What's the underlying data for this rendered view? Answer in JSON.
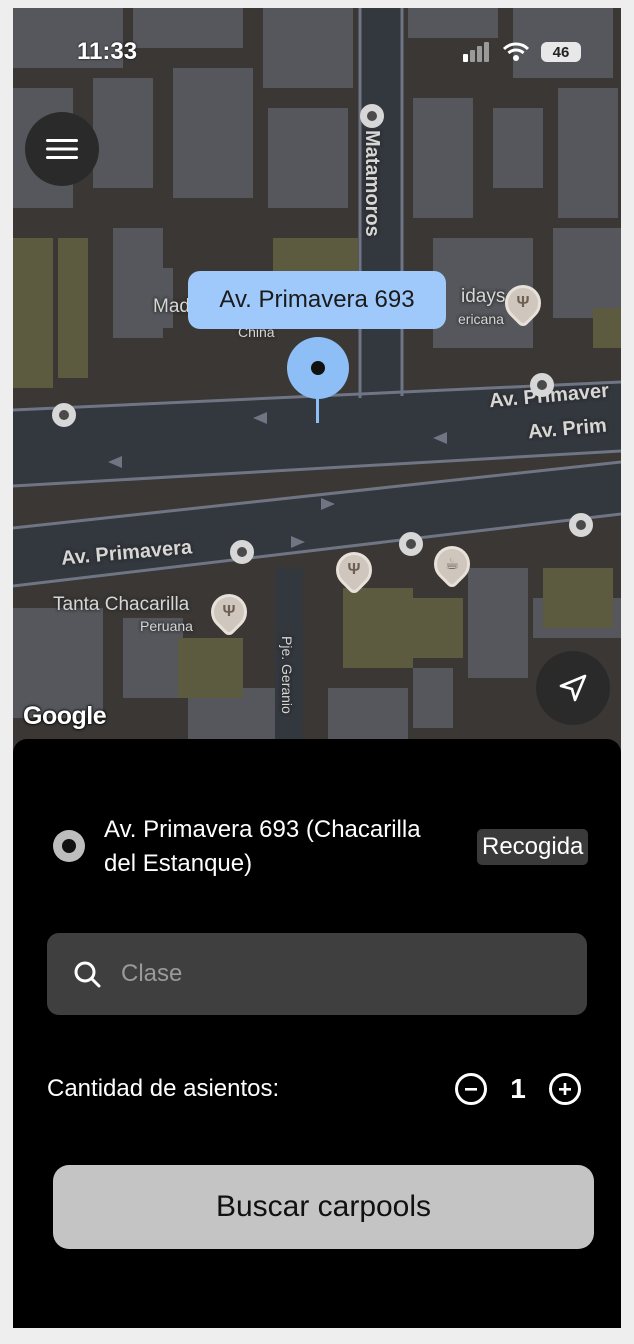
{
  "status_bar": {
    "time": "11:33",
    "battery": "46"
  },
  "map": {
    "pin_address": "Av. Primavera 693",
    "google_logo": "Google",
    "labels": {
      "matamoros": "Matamoros",
      "av_primavera_left": "Av. Primavera",
      "av_primavera_right": "Av. Primaver",
      "av_prim_right": "Av. Prim",
      "tanta": "Tanta Chacarilla",
      "peruana": "Peruana",
      "fridays": "idays",
      "americana": "ericana",
      "madam": "Mad",
      "china": "China",
      "geranio": "Pje. Geranio"
    }
  },
  "origin": {
    "address": "Av. Primavera 693 (Chacarilla del Estanque)",
    "badge": "Recogida"
  },
  "search": {
    "placeholder": "Clase",
    "value": ""
  },
  "seats": {
    "label": "Cantidad de asientos:",
    "value": "1"
  },
  "actions": {
    "search_carpools": "Buscar carpools"
  },
  "colors": {
    "accent_blue": "#9fc8fb",
    "sheet_background": "#000000",
    "button_gray": "#c4c4c4"
  }
}
